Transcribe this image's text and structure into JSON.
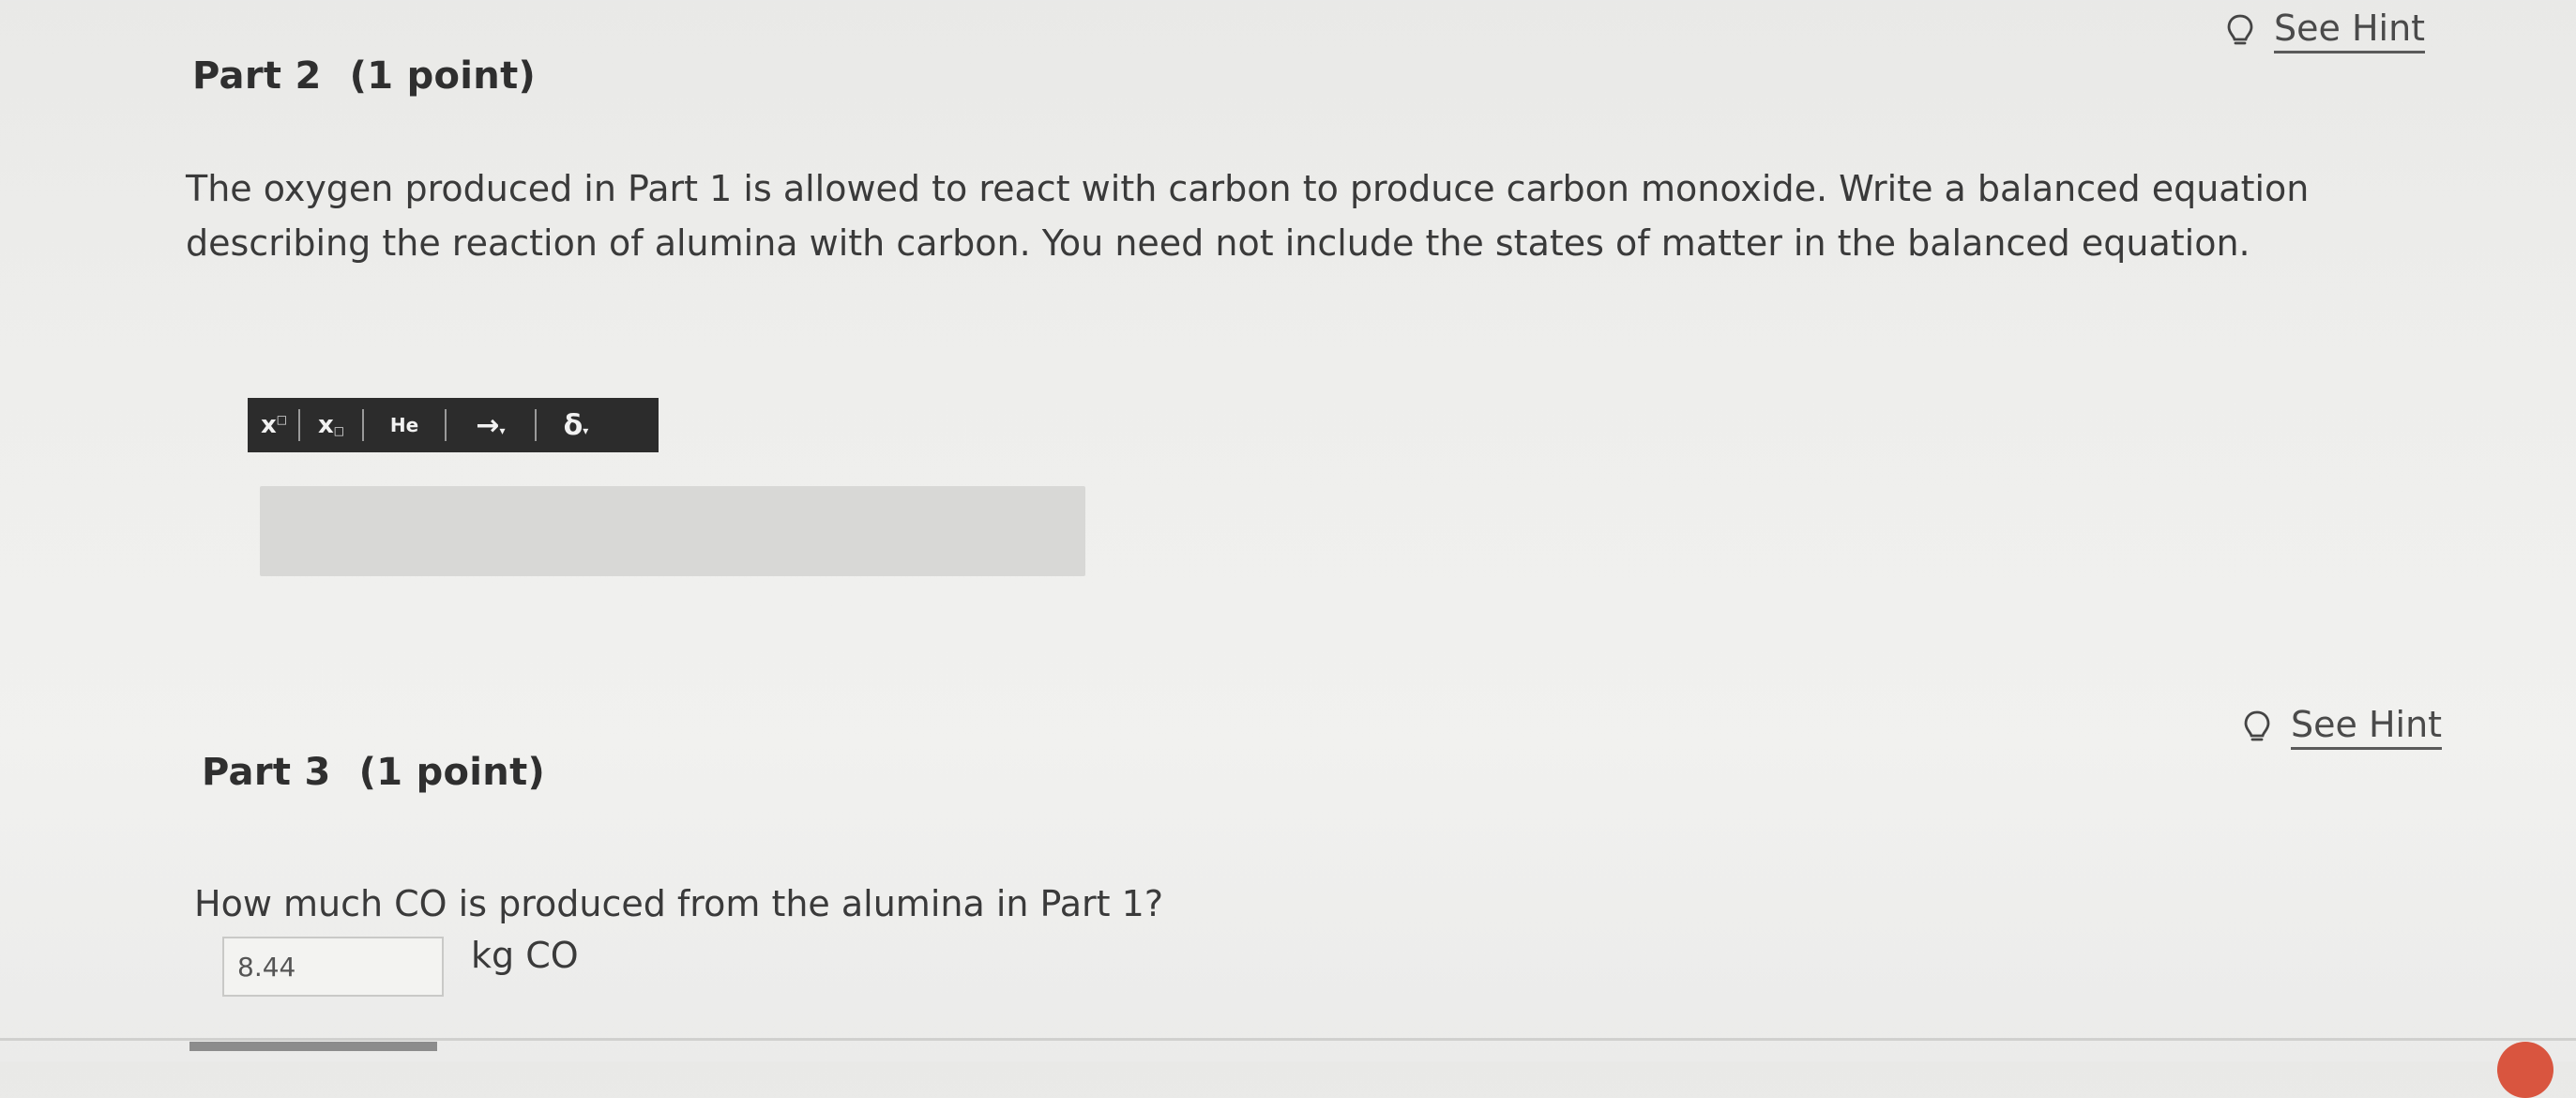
{
  "part2": {
    "title": "Part 2",
    "points": "(1 point)",
    "hint_label": "See Hint",
    "question": "The oxygen produced in Part 1 is allowed to react with carbon to produce carbon monoxide. Write a balanced equation describing the reaction of alumina with carbon. You need not include the states of matter in the balanced equation.",
    "toolbar": {
      "superscript": "x",
      "subscript": "x",
      "element": "He",
      "arrow": "→",
      "delta": "δ"
    },
    "answer_value": ""
  },
  "part3": {
    "title": "Part 3",
    "points": "(1 point)",
    "hint_label": "See Hint",
    "question": "How much CO is produced from the alumina in Part 1?",
    "input_value": "8.44",
    "unit": "kg CO"
  },
  "icons": {
    "hint": "lightbulb-icon"
  },
  "colors": {
    "toolbar_bg": "#2c2c2c",
    "answer_area_bg": "#d8d8d6",
    "badge": "#d9553f"
  }
}
